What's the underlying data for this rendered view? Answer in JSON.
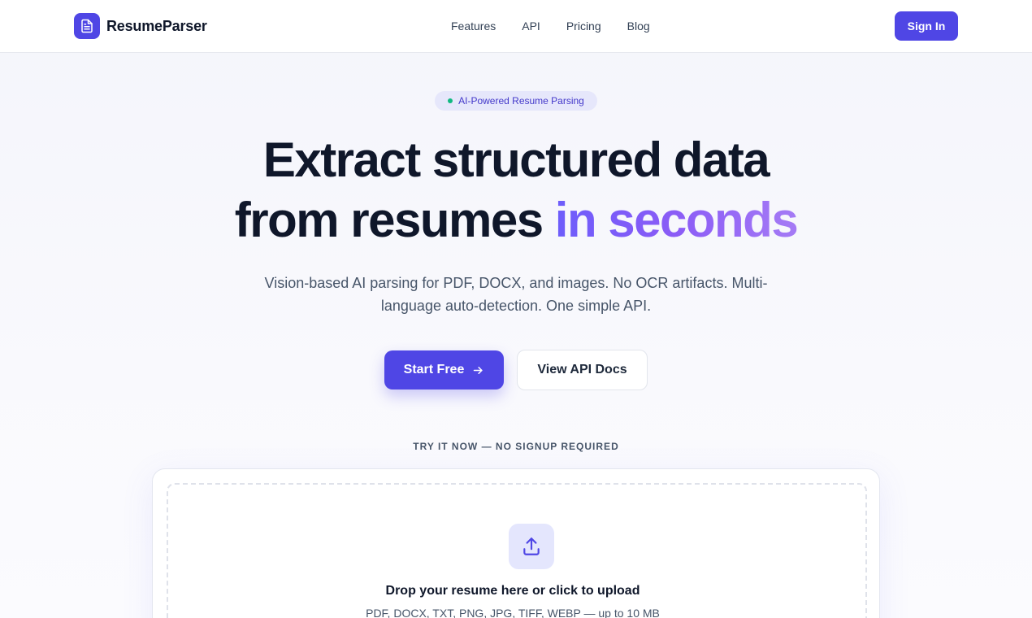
{
  "header": {
    "brand": "ResumeParser",
    "nav": [
      "Features",
      "API",
      "Pricing",
      "Blog"
    ],
    "signin": "Sign In"
  },
  "hero": {
    "badge": "AI-Powered Resume Parsing",
    "headline_line1": "Extract structured data",
    "headline_line2_plain": "from resumes ",
    "headline_line2_accent": "in seconds",
    "subtitle": "Vision-based AI parsing for PDF, DOCX, and images. No OCR artifacts. Multi-language auto-detection. One simple API.",
    "primary_cta": "Start Free",
    "secondary_cta": "View API Docs"
  },
  "try": {
    "label": "TRY IT NOW — NO SIGNUP REQUIRED",
    "drop_title": "Drop your resume here or click to upload",
    "drop_formats": "PDF, DOCX, TXT, PNG, JPG, TIFF, WEBP — up to 10 MB"
  },
  "colors": {
    "brand": "#4f46e5",
    "accent_gradient_start": "#6d5dfb",
    "accent_gradient_end": "#a57bf5",
    "status_dot": "#10b981"
  },
  "icons": {
    "logo": "document-icon",
    "cta_arrow": "arrow-right-icon",
    "upload": "upload-icon"
  }
}
